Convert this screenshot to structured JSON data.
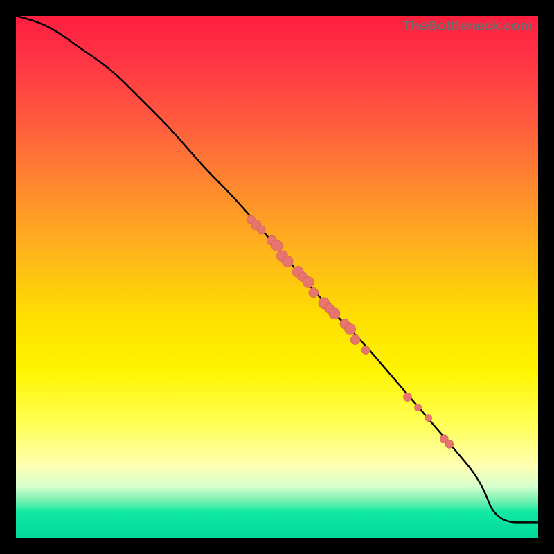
{
  "watermark": "TheBottleneck.com",
  "colors": {
    "curve": "#000000",
    "marker_fill": "#e5756d",
    "marker_stroke": "#d5574f",
    "background_border": "#000000"
  },
  "chart_data": {
    "type": "line",
    "title": "",
    "xlabel": "",
    "ylabel": "",
    "xlim": [
      0,
      100
    ],
    "ylim": [
      0,
      100
    ],
    "curve": {
      "x": [
        0,
        4,
        8,
        12,
        18,
        24,
        30,
        36,
        42,
        48,
        54,
        60,
        66,
        72,
        78,
        84,
        89,
        92,
        100
      ],
      "y": [
        100,
        99,
        97,
        94,
        90,
        84,
        78,
        71,
        65,
        58,
        51,
        44,
        38,
        31,
        24,
        17,
        11,
        3,
        3
      ]
    },
    "markers": [
      {
        "x": 45,
        "y": 61,
        "r": 6
      },
      {
        "x": 46,
        "y": 60,
        "r": 7
      },
      {
        "x": 47,
        "y": 59,
        "r": 6
      },
      {
        "x": 49,
        "y": 57,
        "r": 7
      },
      {
        "x": 50,
        "y": 56,
        "r": 8
      },
      {
        "x": 51,
        "y": 54,
        "r": 8
      },
      {
        "x": 52,
        "y": 53,
        "r": 8
      },
      {
        "x": 54,
        "y": 51,
        "r": 8
      },
      {
        "x": 55,
        "y": 50,
        "r": 7
      },
      {
        "x": 56,
        "y": 49,
        "r": 8
      },
      {
        "x": 57,
        "y": 47,
        "r": 7
      },
      {
        "x": 59,
        "y": 45,
        "r": 8
      },
      {
        "x": 60,
        "y": 44,
        "r": 7
      },
      {
        "x": 61,
        "y": 43,
        "r": 8
      },
      {
        "x": 63,
        "y": 41,
        "r": 7
      },
      {
        "x": 64,
        "y": 40,
        "r": 8
      },
      {
        "x": 65,
        "y": 38,
        "r": 7
      },
      {
        "x": 67,
        "y": 36,
        "r": 6
      },
      {
        "x": 75,
        "y": 27,
        "r": 6
      },
      {
        "x": 77,
        "y": 25,
        "r": 5
      },
      {
        "x": 79,
        "y": 23,
        "r": 5
      },
      {
        "x": 82,
        "y": 19,
        "r": 6
      },
      {
        "x": 83,
        "y": 18,
        "r": 6
      }
    ],
    "annotations": [],
    "grid": false,
    "legend": false
  }
}
